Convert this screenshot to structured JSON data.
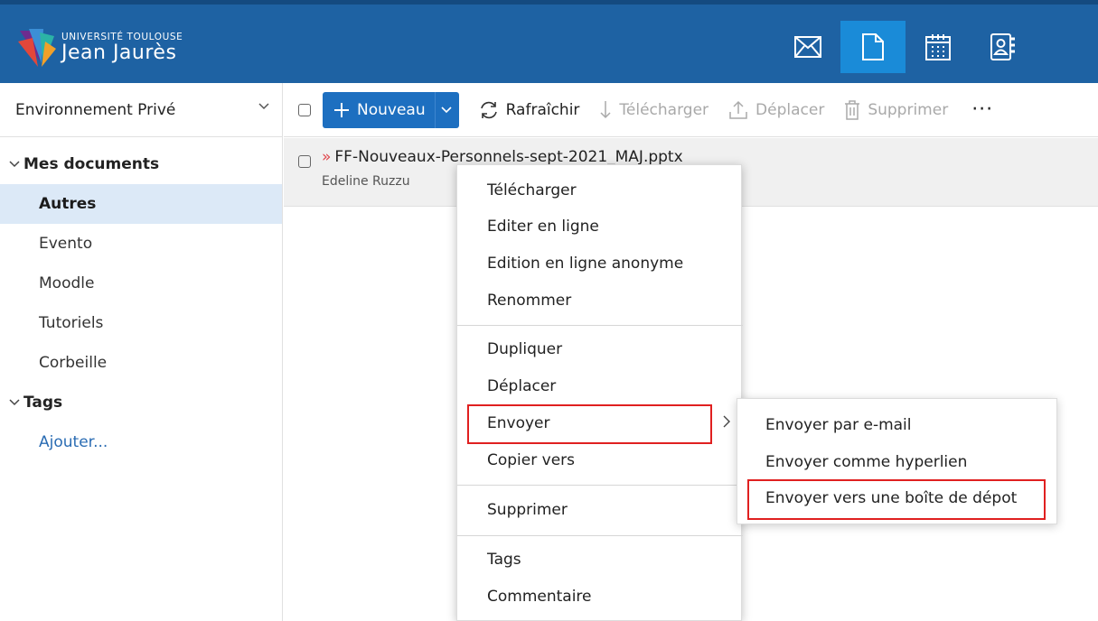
{
  "header": {
    "logo_top": "UNIVERSITÉ TOULOUSE",
    "logo_bottom": "Jean Jaurès",
    "apps": [
      {
        "icon": "mail-icon",
        "active": false
      },
      {
        "icon": "document-icon",
        "active": true
      },
      {
        "icon": "calendar-icon",
        "active": false
      },
      {
        "icon": "contacts-icon",
        "active": false
      }
    ],
    "colors": {
      "bar": "#1e62a3",
      "active": "#1a8bd8"
    }
  },
  "sidebar": {
    "environment": "Environnement Privé",
    "sections": [
      {
        "title": "Mes documents",
        "items": [
          {
            "label": "Autres",
            "selected": true
          },
          {
            "label": "Evento",
            "selected": false
          },
          {
            "label": "Moodle",
            "selected": false
          },
          {
            "label": "Tutoriels",
            "selected": false
          },
          {
            "label": "Corbeille",
            "selected": false
          }
        ]
      },
      {
        "title": "Tags",
        "items": [
          {
            "label": "Ajouter...",
            "link": true
          }
        ]
      }
    ]
  },
  "toolbar": {
    "new_label": "Nouveau",
    "refresh_label": "Rafraîchir",
    "download_label": "Télécharger",
    "move_label": "Déplacer",
    "delete_label": "Supprimer",
    "more_label": "···"
  },
  "files": [
    {
      "name": "FF-Nouveaux-Personnels-sept-2021_MAJ.pptx",
      "marker": "»",
      "author": "Edeline Ruzzu"
    }
  ],
  "context_menu": {
    "groups": [
      [
        "Télécharger",
        "Editer en ligne",
        "Edition en ligne anonyme",
        "Renommer"
      ],
      [
        "Dupliquer",
        "Déplacer",
        "Envoyer",
        "Copier vers"
      ],
      [
        "Supprimer"
      ],
      [
        "Tags",
        "Commentaire"
      ]
    ],
    "highlighted": "Envoyer",
    "highlight_color": "#e02020"
  },
  "submenu": {
    "items": [
      "Envoyer par e-mail",
      "Envoyer comme hyperlien",
      "Envoyer vers une boîte de dépot"
    ],
    "highlighted": "Envoyer vers une boîte de dépot"
  }
}
